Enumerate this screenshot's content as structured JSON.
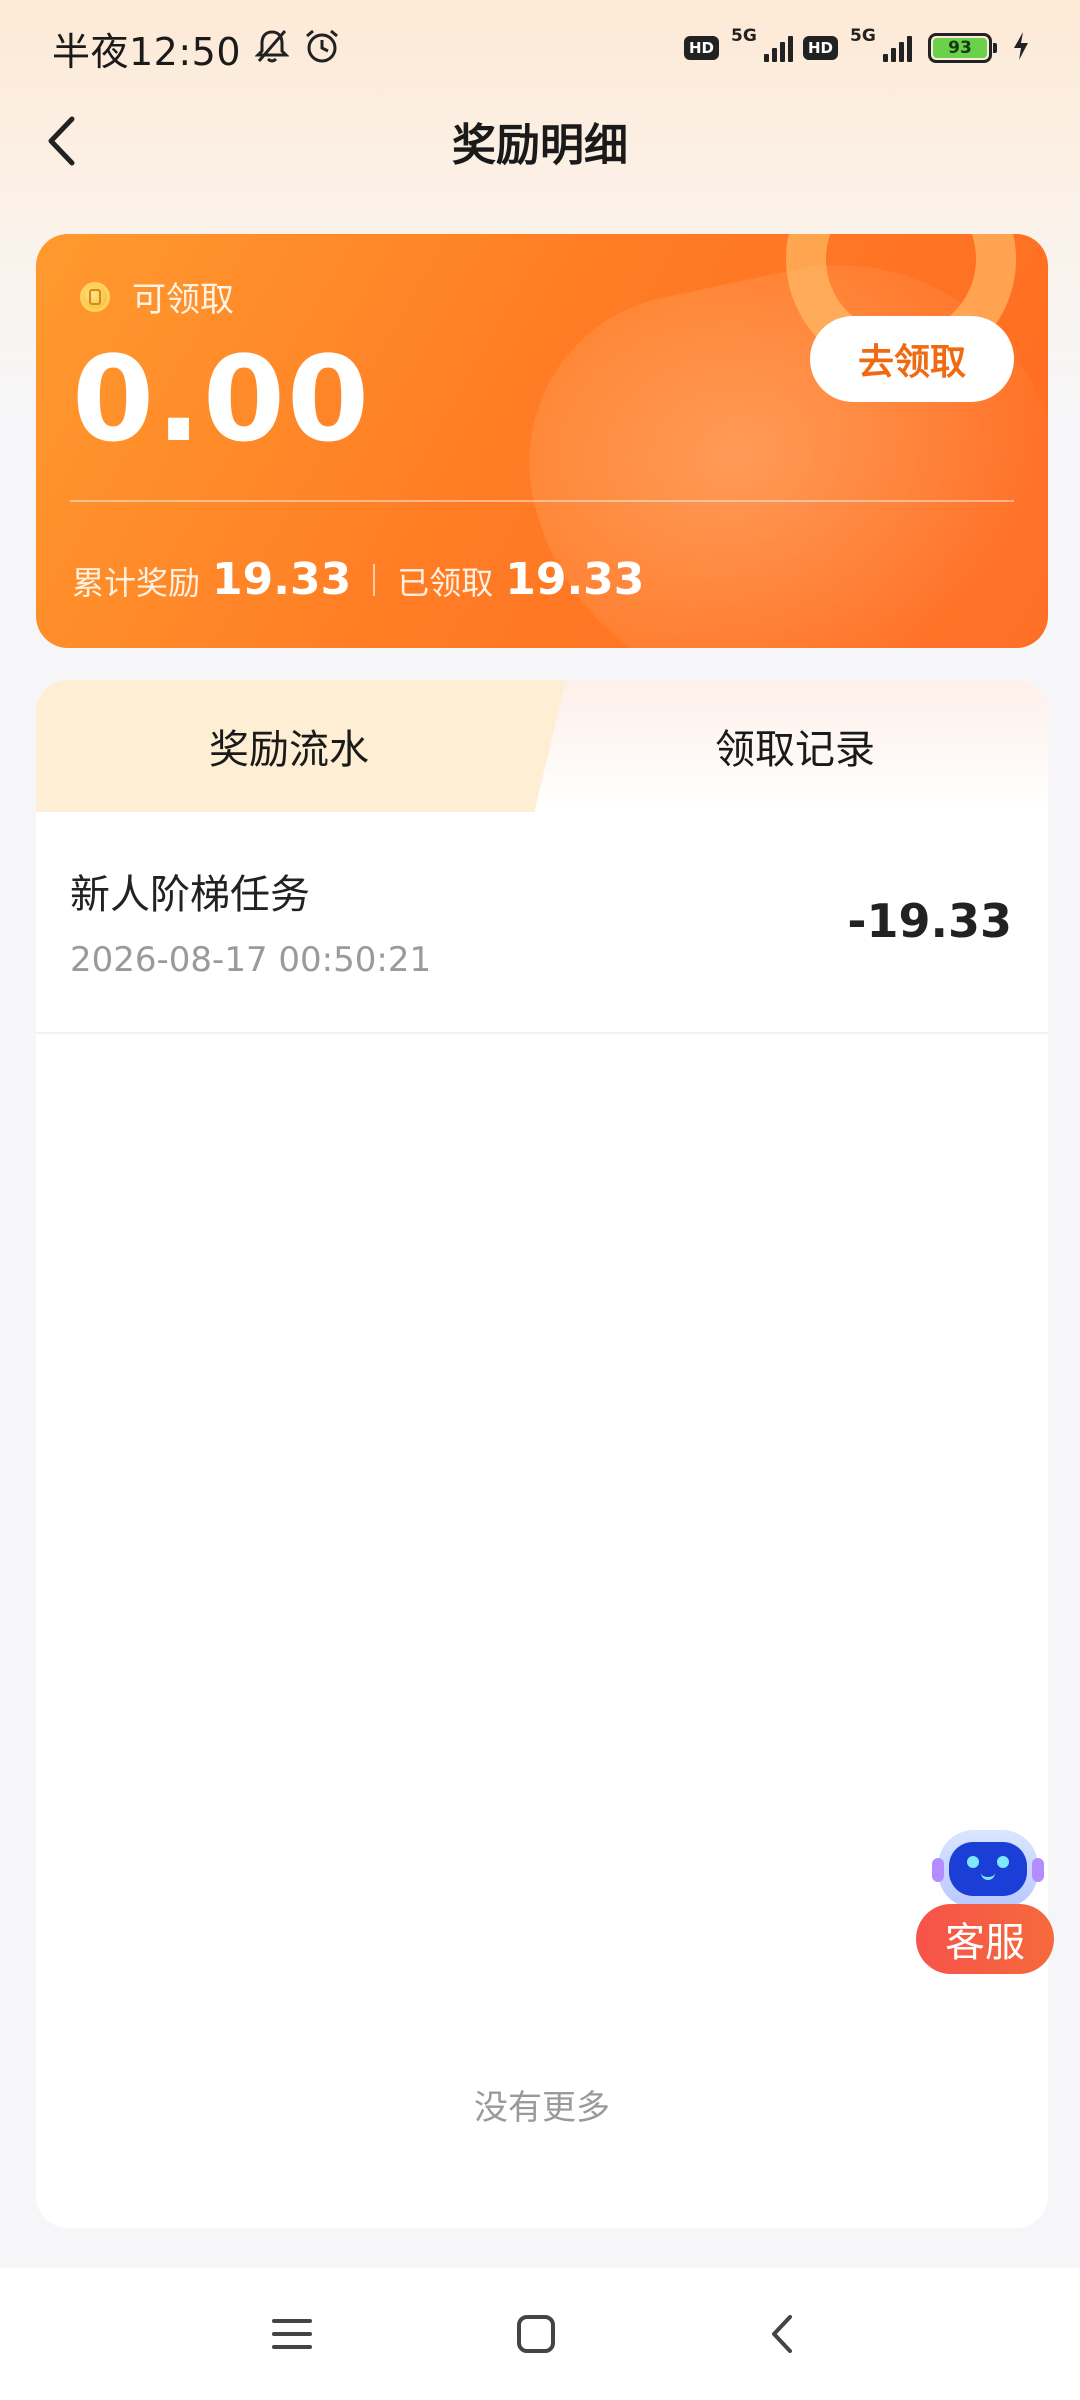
{
  "status_bar": {
    "time": "半夜12:50",
    "net1_label": "5G",
    "net2_label": "5G",
    "hd1": "HD",
    "hd2": "HD",
    "battery": "93",
    "icons": [
      "bell-off-icon",
      "alarm-icon",
      "signal-icon",
      "battery-icon",
      "charging-icon"
    ]
  },
  "header": {
    "title": "奖励明细"
  },
  "reward_card": {
    "available_label": "可领取",
    "available_amount": "0.00",
    "claim_button": "去领取",
    "total_label": "累计奖励",
    "total_value": "19.33",
    "claimed_label": "已领取",
    "claimed_value": "19.33"
  },
  "tabs": [
    {
      "label": "奖励流水",
      "active": true
    },
    {
      "label": "领取记录",
      "active": false
    }
  ],
  "records": [
    {
      "title": "新人阶梯任务",
      "time": "2026-08-17 00:50:21",
      "amount": "-19.33"
    }
  ],
  "list_footer": "没有更多",
  "customer_service": {
    "label": "客服"
  },
  "colors": {
    "accent": "#ff7d25",
    "claim_text": "#f06a12",
    "cs_red": "#f7534a"
  }
}
